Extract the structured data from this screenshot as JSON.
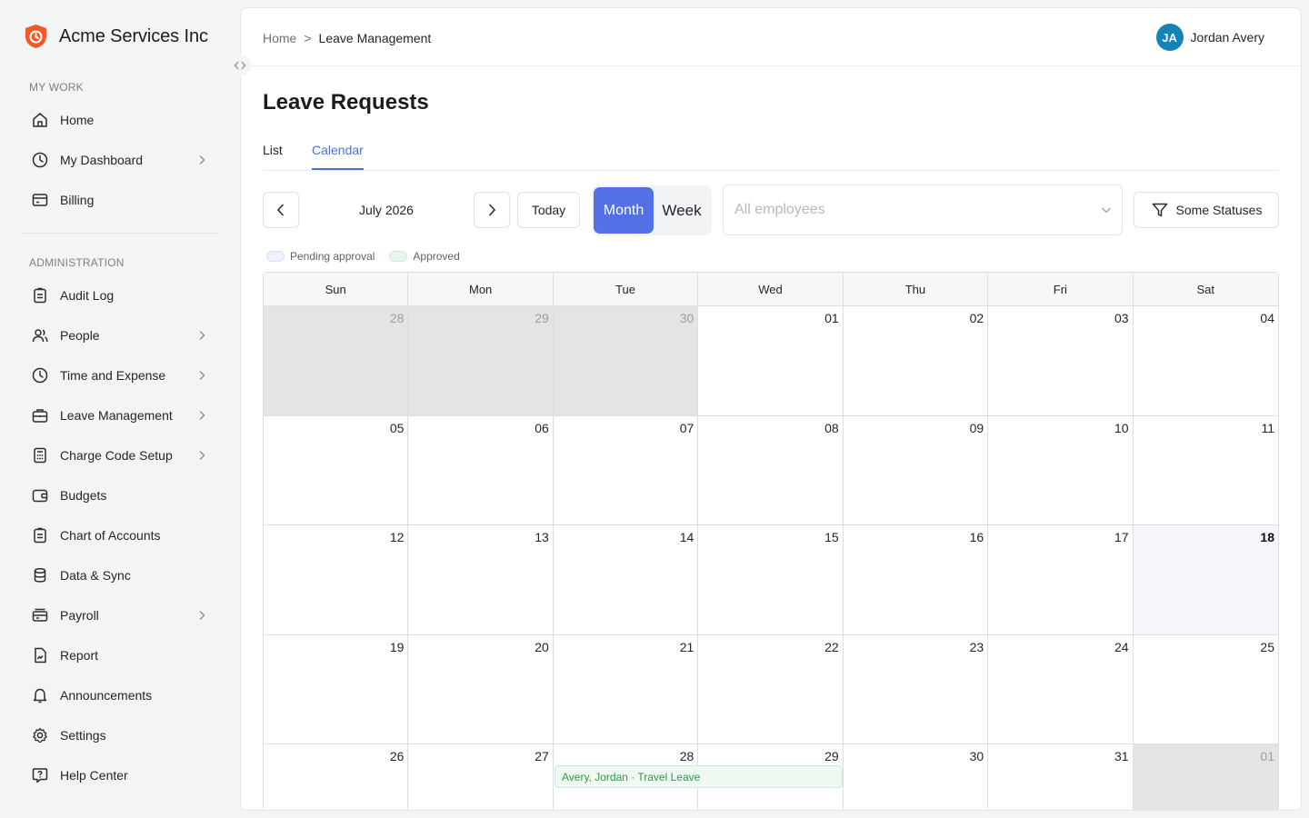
{
  "app": {
    "brand": "Acme Services Inc"
  },
  "sidebar": {
    "sections": [
      {
        "label": "MY WORK"
      },
      {
        "label": "ADMINISTRATION"
      }
    ],
    "items": [
      {
        "label": "Home",
        "icon": "home-icon"
      },
      {
        "label": "My Dashboard",
        "icon": "clock-icon",
        "has_submenu": true
      },
      {
        "label": "Billing",
        "icon": "billing-icon"
      },
      {
        "label": "Audit Log",
        "icon": "clipboard-icon"
      },
      {
        "label": "People",
        "icon": "people-icon",
        "has_submenu": true
      },
      {
        "label": "Time and Expense",
        "icon": "clock-icon",
        "has_submenu": true
      },
      {
        "label": "Leave Management",
        "icon": "briefcase-icon",
        "has_submenu": true
      },
      {
        "label": "Charge Code Setup",
        "icon": "calculator-icon",
        "has_submenu": true
      },
      {
        "label": "Budgets",
        "icon": "wallet-icon"
      },
      {
        "label": "Chart of Accounts",
        "icon": "clipboard-icon"
      },
      {
        "label": "Data & Sync",
        "icon": "database-icon"
      },
      {
        "label": "Payroll",
        "icon": "payroll-icon",
        "has_submenu": true
      },
      {
        "label": "Report",
        "icon": "report-icon"
      },
      {
        "label": "Announcements",
        "icon": "bell-icon"
      },
      {
        "label": "Settings",
        "icon": "gear-icon"
      },
      {
        "label": "Help Center",
        "icon": "help-icon"
      }
    ]
  },
  "header": {
    "breadcrumb": {
      "home": "Home",
      "separator": ">",
      "current": "Leave Management"
    },
    "user": {
      "initials": "JA",
      "name": "Jordan Avery"
    }
  },
  "page": {
    "title": "Leave Requests",
    "tabs": [
      {
        "label": "List"
      },
      {
        "label": "Calendar",
        "active": true
      }
    ]
  },
  "toolbar": {
    "month_label": "July 2026",
    "today_label": "Today",
    "view_month": "Month",
    "view_week": "Week",
    "employee_placeholder": "All employees",
    "status_label": "Some Statuses"
  },
  "legend": {
    "pending": "Pending approval",
    "approved": "Approved"
  },
  "calendar": {
    "weekdays": [
      "Sun",
      "Mon",
      "Tue",
      "Wed",
      "Thu",
      "Fri",
      "Sat"
    ],
    "days": [
      {
        "n": "28",
        "outside": true
      },
      {
        "n": "29",
        "outside": true
      },
      {
        "n": "30",
        "outside": true
      },
      {
        "n": "01"
      },
      {
        "n": "02"
      },
      {
        "n": "03"
      },
      {
        "n": "04"
      },
      {
        "n": "05"
      },
      {
        "n": "06"
      },
      {
        "n": "07"
      },
      {
        "n": "08"
      },
      {
        "n": "09"
      },
      {
        "n": "10"
      },
      {
        "n": "11"
      },
      {
        "n": "12"
      },
      {
        "n": "13"
      },
      {
        "n": "14"
      },
      {
        "n": "15"
      },
      {
        "n": "16"
      },
      {
        "n": "17"
      },
      {
        "n": "18",
        "today": true
      },
      {
        "n": "19"
      },
      {
        "n": "20"
      },
      {
        "n": "21"
      },
      {
        "n": "22"
      },
      {
        "n": "23"
      },
      {
        "n": "24"
      },
      {
        "n": "25"
      },
      {
        "n": "26"
      },
      {
        "n": "27"
      },
      {
        "n": "28"
      },
      {
        "n": "29"
      },
      {
        "n": "30"
      },
      {
        "n": "31"
      },
      {
        "n": "01",
        "outside": true
      }
    ],
    "events": [
      {
        "label": "Avery, Jordan · Travel Leave",
        "status": "approved",
        "start": "2026-07-28",
        "end": "2026-07-29"
      }
    ]
  },
  "colors": {
    "accent": "#5470e6",
    "tab_active": "#4f6fd6",
    "brand_orange": "#f15a24",
    "avatar": "#1582b8",
    "approved_text": "#2c9a4b"
  }
}
